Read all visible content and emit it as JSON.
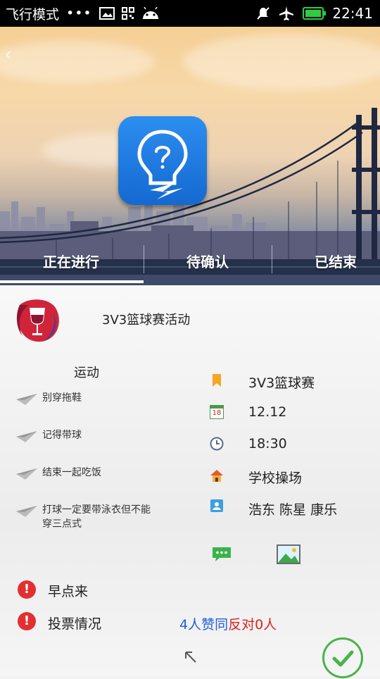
{
  "status_bar": {
    "mode": "飞行模式",
    "dots": "•••",
    "time": "22:41",
    "battery_level": 1.0
  },
  "tabs": [
    {
      "label": "正在进行"
    },
    {
      "label": "待确认"
    },
    {
      "label": "已结束"
    }
  ],
  "activity": {
    "title": "3V3篮球赛活动",
    "category": "运动",
    "notes": [
      "别穿拖鞋",
      "记得带球",
      "结束一起吃饭",
      "打球一定要带泳衣但不能穿三点式"
    ],
    "info": {
      "name": "3V3篮球赛",
      "date": "12.12",
      "time": "18:30",
      "place": "学校操场",
      "participants": "浩东 陈星 康乐"
    },
    "calendar_badge": "18",
    "reminder": "早点来",
    "vote_label": "投票情况",
    "vote_yes": "4人赞同",
    "vote_no": "反对0人"
  },
  "colors": {
    "accent_green": "#49b34a",
    "vote_yes": "#2060d6",
    "vote_no": "#e02020",
    "alert": "#e23030"
  }
}
